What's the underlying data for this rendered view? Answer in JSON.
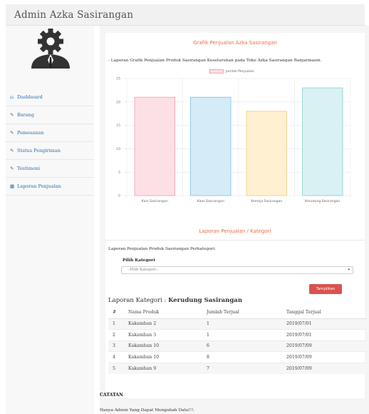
{
  "header": {
    "brand": "Admin Azka Sasirangan"
  },
  "sidebar": {
    "items": [
      {
        "icon": "home-icon",
        "glyph": "⌂",
        "label": "Dashboard"
      },
      {
        "icon": "edit-icon",
        "glyph": "✎",
        "label": "Barang"
      },
      {
        "icon": "edit-icon",
        "glyph": "✎",
        "label": "Pemesanan"
      },
      {
        "icon": "edit-icon",
        "glyph": "✎",
        "label": "Status Pengiriman"
      },
      {
        "icon": "edit-icon",
        "glyph": "✎",
        "label": "Testimoni"
      },
      {
        "icon": "table-icon",
        "glyph": "▦",
        "label": "Laporan Penjualan"
      }
    ]
  },
  "chart_section": {
    "title": "Grafik Penjualan Azka Sasirangan",
    "description": "- Laporan Grafik Penjualan Produk Sasirangan Keseluruhan pada Toko Azka Sasirangan Banjarmasin."
  },
  "chart_data": {
    "type": "bar",
    "categories": [
      "Kain Sasirangan",
      "Kaos Sasirangan",
      "Kemeja Sasirangan",
      "Kerudung Sasirangan"
    ],
    "series": [
      {
        "name": "Jumlah Penjualan",
        "values": [
          21,
          21,
          18,
          23
        ]
      }
    ],
    "ylim": [
      0,
      25
    ],
    "yticks": [
      0,
      5,
      10,
      15,
      20,
      25
    ],
    "grid": true,
    "legend": "top-center",
    "colors": {
      "fills": [
        "#fde0e6",
        "#d6ebf8",
        "#fff0d2",
        "#d9f1f3"
      ],
      "strokes": [
        "#f5a3b5",
        "#8cc4e8",
        "#f7cf86",
        "#8fd3d8"
      ]
    }
  },
  "category_section": {
    "title": "Laporan Penjualan / Kategori",
    "description": "Laporan Penjualan Produk Sasirangan Perkategori.",
    "field_label": "Pilih Kategori",
    "select_value": "--Pilih Kategori--",
    "button_label": "Tampilkan",
    "report_prefix": "Laporan Kategori : ",
    "report_category": "Kerudung Sasirangan"
  },
  "table": {
    "headers": [
      "#",
      "Nama Produk",
      "Jumlah Terjual",
      "Tanggal Terjual"
    ],
    "rows": [
      [
        "1",
        "Kakamban 2",
        "1",
        "2019/07/01"
      ],
      [
        "2",
        "Kakamban 3",
        "1",
        "2019/07/01"
      ],
      [
        "3",
        "Kakamban 10",
        "6",
        "2019/07/09"
      ],
      [
        "4",
        "Kakamban 10",
        "8",
        "2019/07/09"
      ],
      [
        "5",
        "Kakamban 9",
        "7",
        "2019/07/09"
      ]
    ]
  },
  "notes": {
    "title": "CATATAN",
    "text": "Hanya Admin Yang Dapat Mengubah Data!!!."
  },
  "colors": {
    "accent": "#f06a45",
    "link": "#2a6db0",
    "button": "#d9534f"
  }
}
